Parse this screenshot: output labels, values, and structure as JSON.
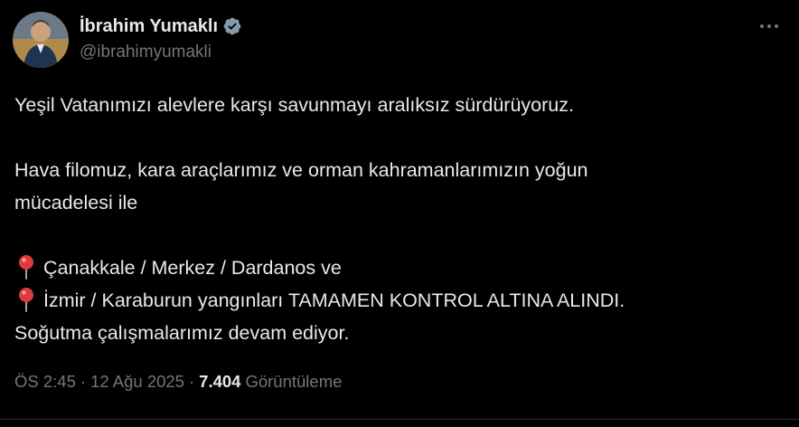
{
  "author": {
    "display_name": "İbrahim Yumaklı",
    "handle": "@ibrahimyumakli",
    "verified_icon": "verified-badge-icon",
    "verified_color": "#829aab"
  },
  "more_icon": "more-options-icon",
  "tweet": {
    "line1": "Yeşil Vatanımızı alevlere karşı savunmayı aralıksız sürdürüyoruz.",
    "line2": "Hava filomuz, kara araçlarımız ve orman kahramanlarımızın yoğun",
    "line3": "mücadelesi ile",
    "line4": "Çanakkale / Merkez / Dardanos ve",
    "line5": "İzmir / Karaburun yangınları TAMAMEN KONTROL ALTINA ALINDI.",
    "line6": "Soğutma çalışmalarımız devam ediyor.",
    "pin_icon": "round-pushpin-icon"
  },
  "meta": {
    "time": "ÖS 2:45",
    "separator": "·",
    "date": "12 Ağu 2025",
    "views_count": "7.404",
    "views_label": "Görüntüleme"
  },
  "colors": {
    "background": "#000000",
    "text": "#e7e9ea",
    "secondary": "#71767b",
    "pin_red": "#e03a3e"
  }
}
